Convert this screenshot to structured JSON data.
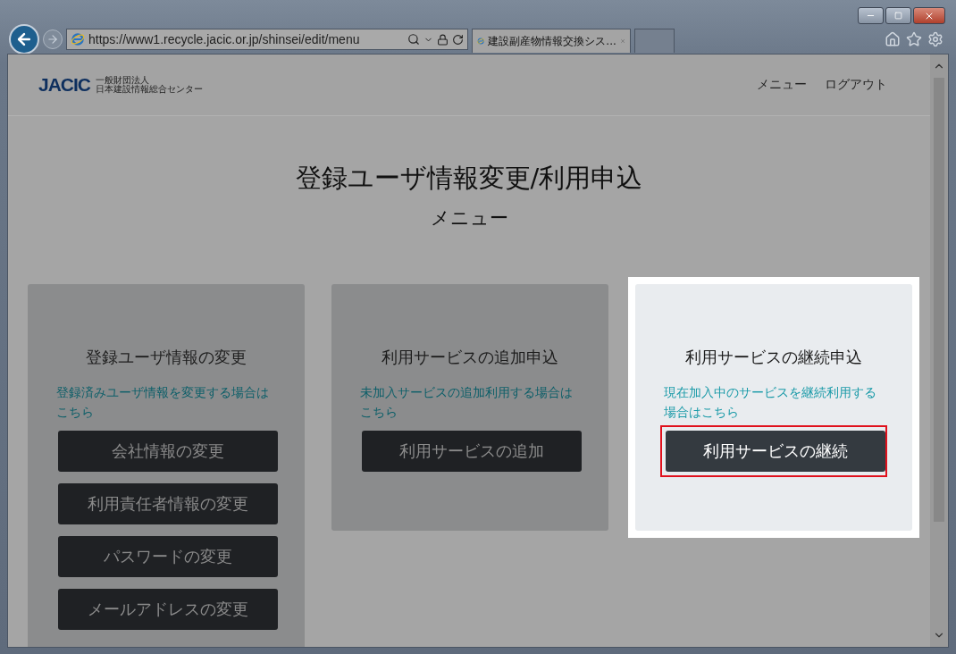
{
  "browser": {
    "address": "https://www1.recycle.jacic.or.jp/shinsei/edit/menu",
    "tab_title": "建設副産物情報交換シス..."
  },
  "header": {
    "logo_mark": "JACIC",
    "logo_lines": [
      "一般財団法人",
      "日本建設情報総合センター"
    ],
    "nav": [
      "メニュー",
      "ログアウト"
    ]
  },
  "title": "登録ユーザ情報変更/利用申込",
  "subtitle": "メニュー",
  "cards": [
    {
      "title": "登録ユーザ情報の変更",
      "note": "登録済みユーザ情報を変更する場合はこちら",
      "highlighted": false,
      "buttons": [
        {
          "label": "会社情報の変更",
          "marked": false
        },
        {
          "label": "利用責任者情報の変更",
          "marked": false
        },
        {
          "label": "パスワードの変更",
          "marked": false
        },
        {
          "label": "メールアドレスの変更",
          "marked": false
        }
      ]
    },
    {
      "title": "利用サービスの追加申込",
      "note": "未加入サービスの追加利用する場合はこちら",
      "highlighted": false,
      "buttons": [
        {
          "label": "利用サービスの追加",
          "marked": false
        }
      ]
    },
    {
      "title": "利用サービスの継続申込",
      "note": "現在加入中のサービスを継続利用する場合はこちら",
      "highlighted": true,
      "buttons": [
        {
          "label": "利用サービスの継続",
          "marked": true
        }
      ]
    }
  ]
}
